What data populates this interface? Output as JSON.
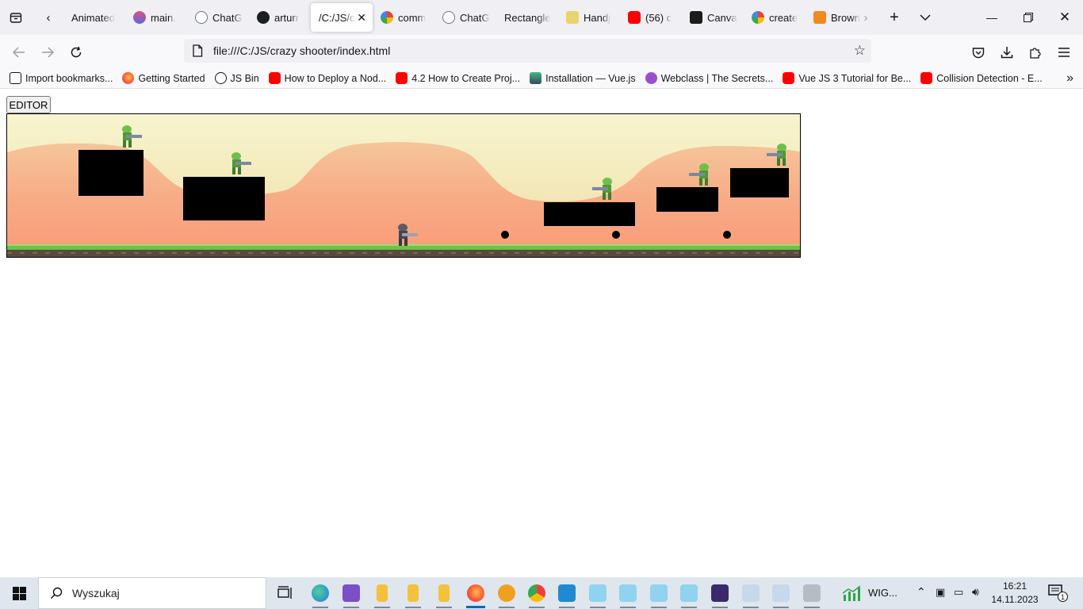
{
  "tabs": [
    {
      "title": "Animated",
      "icon": "none"
    },
    {
      "title": "main.",
      "icon": "main-icon"
    },
    {
      "title": "ChatG",
      "icon": "chatgpt-icon"
    },
    {
      "title": "arturr",
      "icon": "github-icon"
    },
    {
      "title": "/C:/JS/c",
      "icon": "none",
      "active": true
    },
    {
      "title": "comm",
      "icon": "google-icon"
    },
    {
      "title": "ChatG",
      "icon": "chatgpt-icon"
    },
    {
      "title": "Rectangle",
      "icon": "none"
    },
    {
      "title": "Handj",
      "icon": "handj-icon"
    },
    {
      "title": "(56) c",
      "icon": "youtube-icon"
    },
    {
      "title": "Canva",
      "icon": "canva-icon"
    },
    {
      "title": "create",
      "icon": "google-icon"
    },
    {
      "title": "Brown",
      "icon": "brown-icon"
    }
  ],
  "url": "file:///C:/JS/crazy shooter/index.html",
  "bookmarks": [
    {
      "label": "Import bookmarks...",
      "icon": "import-icon"
    },
    {
      "label": "Getting Started",
      "icon": "firefox-icon"
    },
    {
      "label": "JS Bin",
      "icon": "globe-icon"
    },
    {
      "label": "How to Deploy a Nod...",
      "icon": "youtube-icon"
    },
    {
      "label": "4.2 How to Create Proj...",
      "icon": "youtube-icon"
    },
    {
      "label": "Installation — Vue.js",
      "icon": "vue-icon"
    },
    {
      "label": "Webclass | The Secrets...",
      "icon": "webclass-icon"
    },
    {
      "label": "Vue JS 3 Tutorial for Be...",
      "icon": "youtube-icon"
    },
    {
      "label": "Collision Detection - E...",
      "icon": "youtube-icon"
    }
  ],
  "editor_button": "EDITOR",
  "taskbar": {
    "search_placeholder": "Wyszukaj",
    "tray_label": "WIG...",
    "time": "16:21",
    "date": "14.11.2023",
    "notifications": "1"
  },
  "colors": {
    "sky_top": "#f6f3c9",
    "dune_light": "#f5c59a",
    "dune_mid": "#f7ae86",
    "dune_low": "#fb9a79",
    "grass": "#6cc24a",
    "dirt": "#5a4a3c",
    "platform": "#000000",
    "enemy": "#6fbf4b",
    "player": "#5c5c66"
  }
}
